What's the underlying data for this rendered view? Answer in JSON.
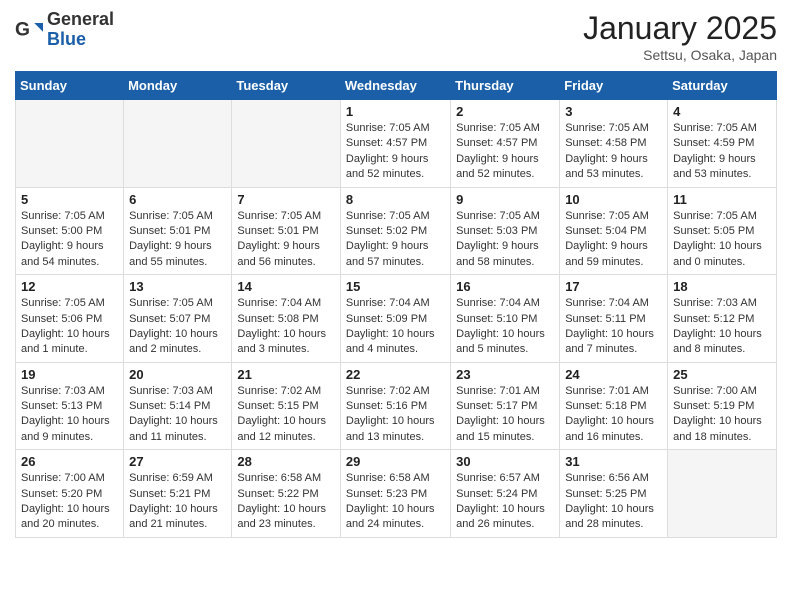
{
  "header": {
    "logo_general": "General",
    "logo_blue": "Blue",
    "title": "January 2025",
    "subtitle": "Settsu, Osaka, Japan"
  },
  "days_of_week": [
    "Sunday",
    "Monday",
    "Tuesday",
    "Wednesday",
    "Thursday",
    "Friday",
    "Saturday"
  ],
  "weeks": [
    [
      {
        "day": null
      },
      {
        "day": null
      },
      {
        "day": null
      },
      {
        "day": "1",
        "sunrise": "7:05 AM",
        "sunset": "4:57 PM",
        "daylight": "9 hours and 52 minutes."
      },
      {
        "day": "2",
        "sunrise": "7:05 AM",
        "sunset": "4:57 PM",
        "daylight": "9 hours and 52 minutes."
      },
      {
        "day": "3",
        "sunrise": "7:05 AM",
        "sunset": "4:58 PM",
        "daylight": "9 hours and 53 minutes."
      },
      {
        "day": "4",
        "sunrise": "7:05 AM",
        "sunset": "4:59 PM",
        "daylight": "9 hours and 53 minutes."
      }
    ],
    [
      {
        "day": "5",
        "sunrise": "7:05 AM",
        "sunset": "5:00 PM",
        "daylight": "9 hours and 54 minutes."
      },
      {
        "day": "6",
        "sunrise": "7:05 AM",
        "sunset": "5:01 PM",
        "daylight": "9 hours and 55 minutes."
      },
      {
        "day": "7",
        "sunrise": "7:05 AM",
        "sunset": "5:01 PM",
        "daylight": "9 hours and 56 minutes."
      },
      {
        "day": "8",
        "sunrise": "7:05 AM",
        "sunset": "5:02 PM",
        "daylight": "9 hours and 57 minutes."
      },
      {
        "day": "9",
        "sunrise": "7:05 AM",
        "sunset": "5:03 PM",
        "daylight": "9 hours and 58 minutes."
      },
      {
        "day": "10",
        "sunrise": "7:05 AM",
        "sunset": "5:04 PM",
        "daylight": "9 hours and 59 minutes."
      },
      {
        "day": "11",
        "sunrise": "7:05 AM",
        "sunset": "5:05 PM",
        "daylight": "10 hours and 0 minutes."
      }
    ],
    [
      {
        "day": "12",
        "sunrise": "7:05 AM",
        "sunset": "5:06 PM",
        "daylight": "10 hours and 1 minute."
      },
      {
        "day": "13",
        "sunrise": "7:05 AM",
        "sunset": "5:07 PM",
        "daylight": "10 hours and 2 minutes."
      },
      {
        "day": "14",
        "sunrise": "7:04 AM",
        "sunset": "5:08 PM",
        "daylight": "10 hours and 3 minutes."
      },
      {
        "day": "15",
        "sunrise": "7:04 AM",
        "sunset": "5:09 PM",
        "daylight": "10 hours and 4 minutes."
      },
      {
        "day": "16",
        "sunrise": "7:04 AM",
        "sunset": "5:10 PM",
        "daylight": "10 hours and 5 minutes."
      },
      {
        "day": "17",
        "sunrise": "7:04 AM",
        "sunset": "5:11 PM",
        "daylight": "10 hours and 7 minutes."
      },
      {
        "day": "18",
        "sunrise": "7:03 AM",
        "sunset": "5:12 PM",
        "daylight": "10 hours and 8 minutes."
      }
    ],
    [
      {
        "day": "19",
        "sunrise": "7:03 AM",
        "sunset": "5:13 PM",
        "daylight": "10 hours and 9 minutes."
      },
      {
        "day": "20",
        "sunrise": "7:03 AM",
        "sunset": "5:14 PM",
        "daylight": "10 hours and 11 minutes."
      },
      {
        "day": "21",
        "sunrise": "7:02 AM",
        "sunset": "5:15 PM",
        "daylight": "10 hours and 12 minutes."
      },
      {
        "day": "22",
        "sunrise": "7:02 AM",
        "sunset": "5:16 PM",
        "daylight": "10 hours and 13 minutes."
      },
      {
        "day": "23",
        "sunrise": "7:01 AM",
        "sunset": "5:17 PM",
        "daylight": "10 hours and 15 minutes."
      },
      {
        "day": "24",
        "sunrise": "7:01 AM",
        "sunset": "5:18 PM",
        "daylight": "10 hours and 16 minutes."
      },
      {
        "day": "25",
        "sunrise": "7:00 AM",
        "sunset": "5:19 PM",
        "daylight": "10 hours and 18 minutes."
      }
    ],
    [
      {
        "day": "26",
        "sunrise": "7:00 AM",
        "sunset": "5:20 PM",
        "daylight": "10 hours and 20 minutes."
      },
      {
        "day": "27",
        "sunrise": "6:59 AM",
        "sunset": "5:21 PM",
        "daylight": "10 hours and 21 minutes."
      },
      {
        "day": "28",
        "sunrise": "6:58 AM",
        "sunset": "5:22 PM",
        "daylight": "10 hours and 23 minutes."
      },
      {
        "day": "29",
        "sunrise": "6:58 AM",
        "sunset": "5:23 PM",
        "daylight": "10 hours and 24 minutes."
      },
      {
        "day": "30",
        "sunrise": "6:57 AM",
        "sunset": "5:24 PM",
        "daylight": "10 hours and 26 minutes."
      },
      {
        "day": "31",
        "sunrise": "6:56 AM",
        "sunset": "5:25 PM",
        "daylight": "10 hours and 28 minutes."
      },
      {
        "day": null
      }
    ]
  ]
}
